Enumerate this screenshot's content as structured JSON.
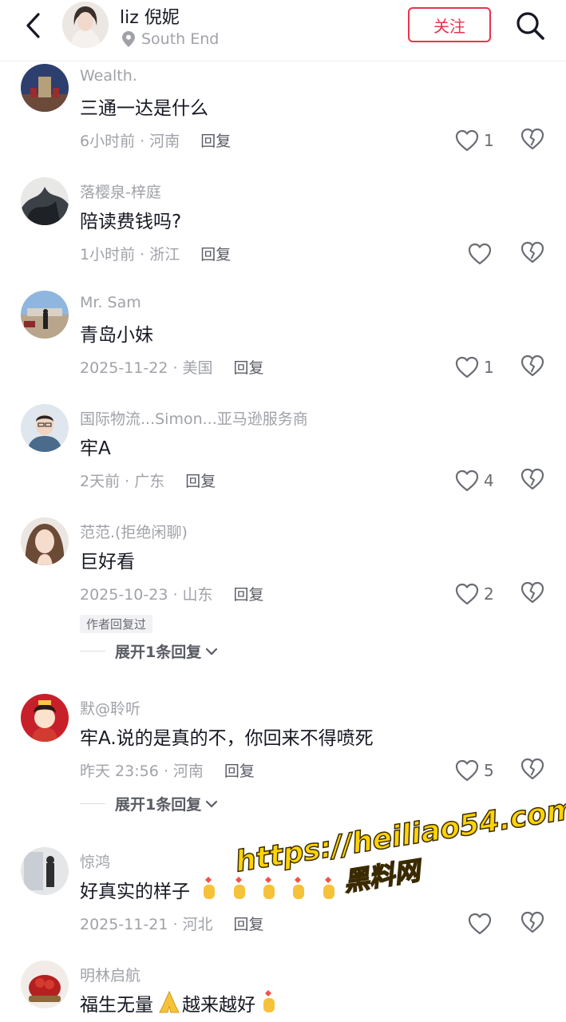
{
  "header": {
    "name": "liz 倪妮",
    "location": "South End",
    "follow_label": "关注",
    "back_icon": "chevron-left-icon",
    "search_icon": "search-icon"
  },
  "comments": [
    {
      "user": "Wealth.",
      "text": "三通一达是什么",
      "time": "6小时前 · 河南",
      "reply": "回复",
      "likes": "1"
    },
    {
      "user": "落樱泉-梓庭",
      "text": "陪读费钱吗?",
      "time": "1小时前 · 浙江",
      "reply": "回复",
      "likes": ""
    },
    {
      "user": "Mr. Sam",
      "text": "青岛小妹",
      "time": "2025-11-22 · 美国",
      "reply": "回复",
      "likes": "1"
    },
    {
      "user": "国际物流...Simon...亚马逊服务商",
      "text": "牢A",
      "time": "2天前 · 广东",
      "reply": "回复",
      "likes": "4"
    },
    {
      "user": "范范.(拒绝闲聊)",
      "text": "巨好看",
      "time": "2025-10-23 · 山东",
      "reply": "回复",
      "likes": "2",
      "tag": "作者回复过",
      "expand": "展开1条回复"
    },
    {
      "user": "默@聆听",
      "text": "牢A.说的是真的不，你回来不得喷死",
      "time": "昨天 23:56 · 河南",
      "reply": "回复",
      "likes": "5",
      "expand": "展开1条回复"
    },
    {
      "user": "惊鸿",
      "text": "好真实的样子",
      "time": "2025-11-21 · 河北",
      "reply": "回复",
      "likes": ""
    },
    {
      "user": "明林启航",
      "text": "福生无量",
      "text2": "越来越好",
      "time": "",
      "reply": "",
      "likes": ""
    }
  ],
  "watermark": {
    "line1": "https://heiliao54.com",
    "line2": "黑料网"
  },
  "colors": {
    "accent": "#e6344e",
    "muted": "#a0a2a8",
    "text": "#161823"
  }
}
